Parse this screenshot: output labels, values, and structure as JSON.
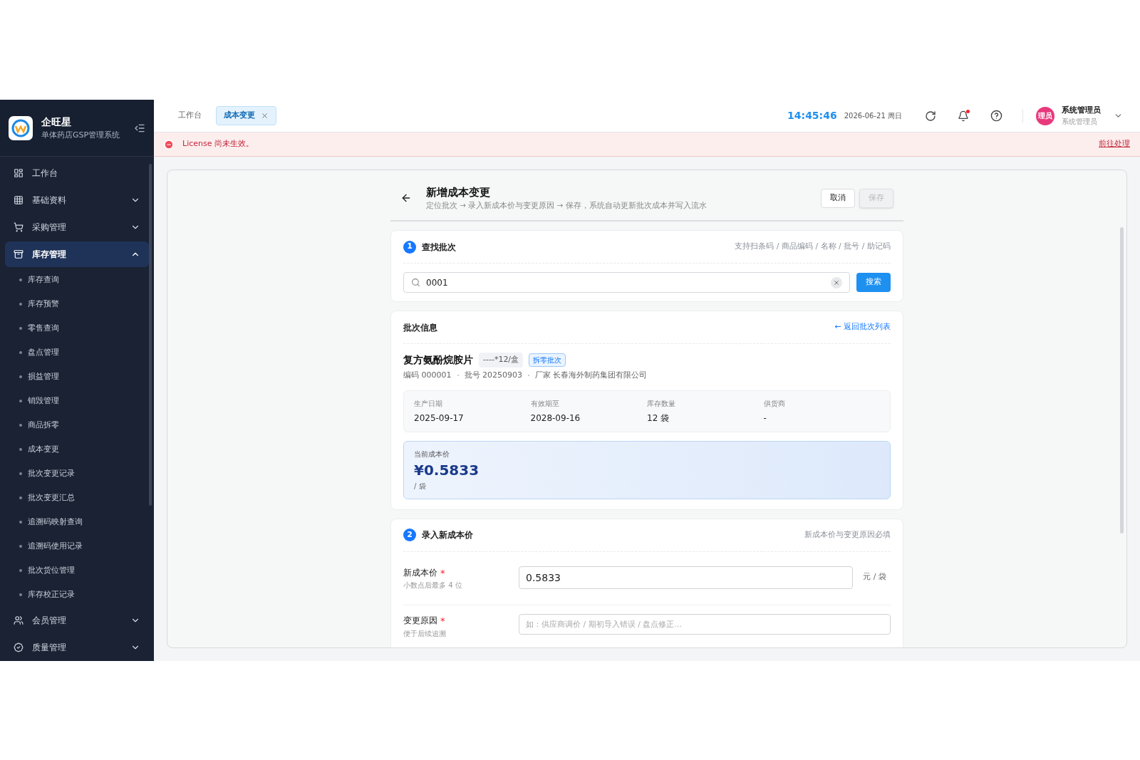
{
  "sidebar": {
    "brand": {
      "name": "企旺星",
      "subtitle": "单体药店GSP管理系统"
    },
    "items": [
      {
        "label": "工作台",
        "selected": false
      },
      {
        "label": "基础资料",
        "selected": false,
        "expanded": false
      },
      {
        "label": "采购管理",
        "selected": false,
        "expanded": false
      },
      {
        "label": "库存管理",
        "selected": true,
        "expanded": true,
        "children": [
          {
            "label": "库存查询",
            "selected": false
          },
          {
            "label": "库存预警",
            "selected": false
          },
          {
            "label": "零售查询",
            "selected": false
          },
          {
            "label": "盘点管理",
            "selected": false
          },
          {
            "label": "损益管理",
            "selected": false
          },
          {
            "label": "销毁管理",
            "selected": false
          },
          {
            "label": "商品拆零",
            "selected": false
          },
          {
            "label": "成本变更",
            "selected": false
          },
          {
            "label": "批次变更记录",
            "selected": false
          },
          {
            "label": "批次变更汇总",
            "selected": false
          },
          {
            "label": "追溯码映射查询",
            "selected": false
          },
          {
            "label": "追溯码使用记录",
            "selected": false
          },
          {
            "label": "批次货位管理",
            "selected": false
          },
          {
            "label": "库存校正记录",
            "selected": false
          }
        ]
      },
      {
        "label": "会员管理",
        "selected": false,
        "expanded": false
      },
      {
        "label": "质量管理",
        "selected": false,
        "expanded": false
      }
    ]
  },
  "header": {
    "tabs": [
      {
        "label": "工作台",
        "selected": false
      },
      {
        "label": "成本变更",
        "selected": true
      }
    ],
    "time": "14:45:46",
    "date": "2026-06-21 周日",
    "has_unread": true,
    "user": {
      "avatar": "理员",
      "name": "系统管理员",
      "role": "系统管理员"
    }
  },
  "banner": {
    "message": "License 尚未生效。",
    "action": "前往处理"
  },
  "page": {
    "title": "新增成本变更",
    "subtitle": "定位批次 → 录入新成本价与变更原因 → 保存，系统自动更新批次成本并写入流水",
    "buttons": [
      {
        "label": "取消",
        "disabled": false
      },
      {
        "label": "保存",
        "disabled": true
      }
    ]
  },
  "find_section": {
    "step": "1",
    "title": "查找批次",
    "hint": "支持扫条码 / 商品编码 / 名称 / 批号 / 助记码",
    "search": {
      "value": "0001"
    },
    "search_button": "搜索"
  },
  "batch_info": {
    "title": "批次信息",
    "back_link": "← 返回批次列表",
    "product": "复方氨酚烷胺片",
    "spec": "----*12/盒",
    "tag": "拆零批次",
    "meta": [
      "编码 000001",
      "批号 20250903",
      "厂家 长春海外制药集团有限公司"
    ],
    "fields": [
      {
        "label": "生产日期",
        "value": "2025-09-17"
      },
      {
        "label": "有效期至",
        "value": "2028-09-16"
      },
      {
        "label": "库存数量",
        "value": "12 袋"
      },
      {
        "label": "供货商",
        "value": "-"
      }
    ],
    "cost": {
      "label": "当前成本价",
      "value": "¥0.5833",
      "unit": "/ 袋"
    }
  },
  "entry_section": {
    "step": "2",
    "title": "录入新成本价",
    "hint": "新成本价与变更原因必填",
    "price": {
      "label": "新成本价",
      "required_mark": "*",
      "help": "小数点后最多 4 位",
      "value": "0.5833",
      "unit": "元 / 袋"
    },
    "reason": {
      "label": "变更原因",
      "required_mark": "*",
      "help": "便于后续追溯",
      "placeholder": "如：供应商调价 / 期初导入错误 / 盘点修正..."
    }
  }
}
